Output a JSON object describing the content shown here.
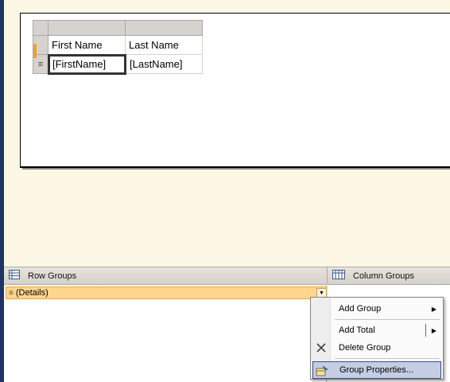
{
  "tablix": {
    "headers": [
      "First Name",
      "Last Name"
    ],
    "fields": [
      "[FirstName]",
      "[LastName]"
    ],
    "row_handle_glyph": "≡"
  },
  "row_groups": {
    "title": "Row Groups",
    "icon": "row-groups-icon",
    "details_label": "(Details)",
    "details_icon": "details-lines-icon",
    "dropdown_glyph": "▼"
  },
  "column_groups": {
    "title": "Column Groups",
    "icon": "column-groups-icon"
  },
  "context_menu": {
    "items": [
      {
        "label": "Add Group",
        "has_submenu": true,
        "arrow": "▶"
      },
      {
        "label": "Add Total",
        "has_submenu": true,
        "arrow": "▶"
      },
      {
        "label": "Delete Group",
        "icon": "delete-x-icon"
      },
      {
        "label": "Group Properties...",
        "icon": "group-properties-icon",
        "highlighted": true
      }
    ]
  },
  "colors": {
    "surface": "#fdf8e6",
    "details_group": "#ffd68c",
    "menu_highlight": "#c5cde4",
    "selection_marker": "#f0a028"
  }
}
